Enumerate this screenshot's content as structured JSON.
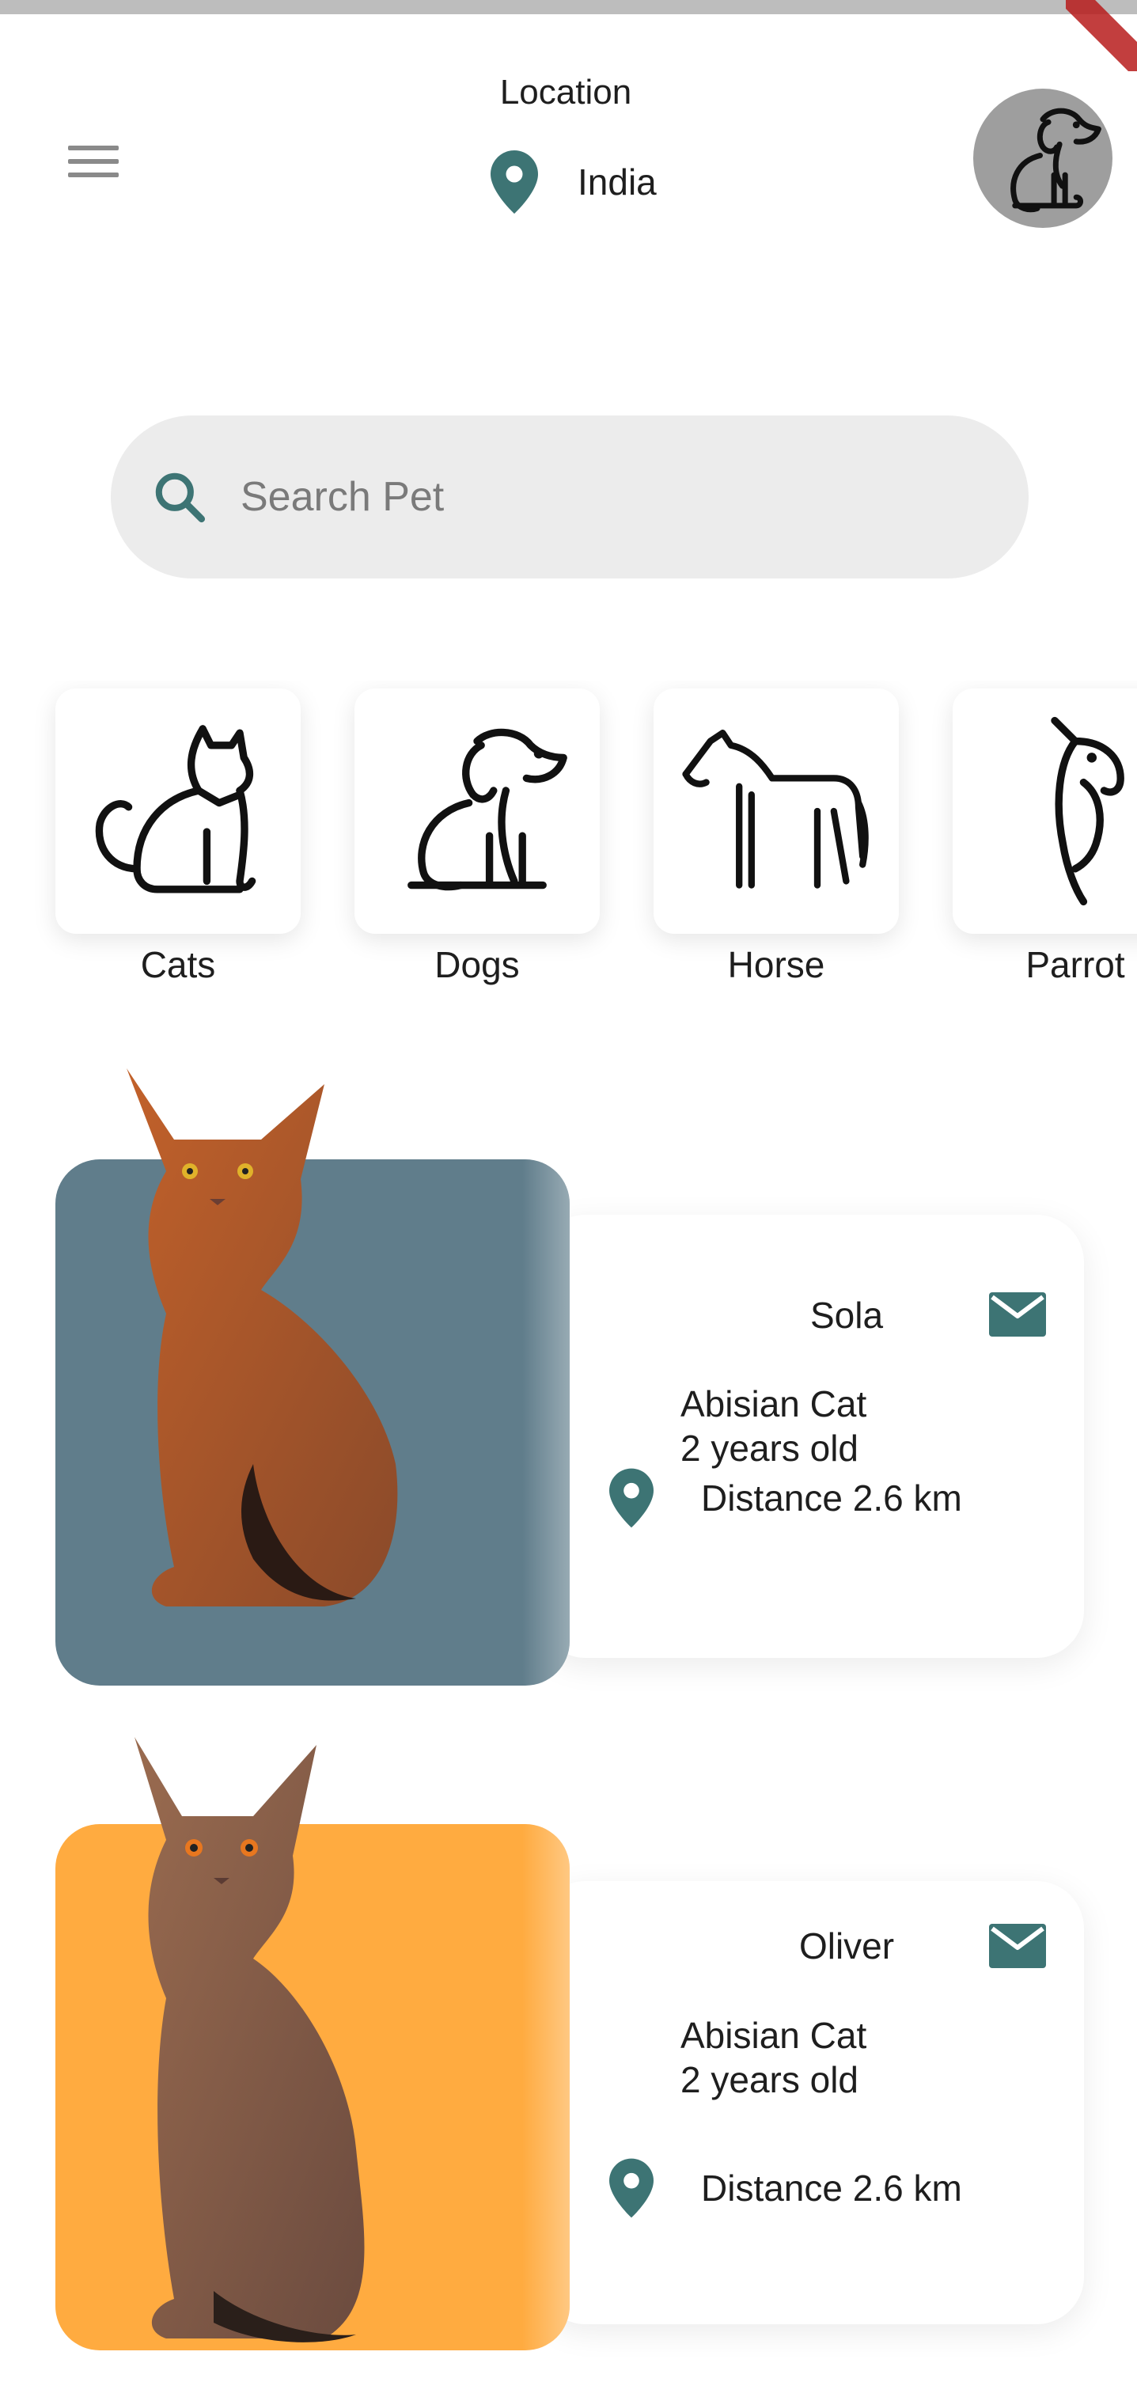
{
  "header": {
    "location_label": "Location",
    "location_value": "India",
    "menu_icon": "menu-icon",
    "location_icon": "map-pin-icon",
    "avatar_icon": "dog-avatar-icon"
  },
  "search": {
    "placeholder": "Search Pet",
    "icon": "search-icon"
  },
  "categories": [
    {
      "label": "Cats",
      "icon": "cat-outline-icon"
    },
    {
      "label": "Dogs",
      "icon": "dog-outline-icon"
    },
    {
      "label": "Horse",
      "icon": "horse-outline-icon"
    },
    {
      "label": "Parrot",
      "icon": "parrot-outline-icon"
    }
  ],
  "pets": [
    {
      "name": "Sola",
      "breed": "Abisian Cat",
      "age": "2 years old",
      "distance": "Distance 2.6 km",
      "card_color": "#607d8b"
    },
    {
      "name": "Oliver",
      "breed": "Abisian Cat",
      "age": "2 years old",
      "distance": "Distance 2.6 km",
      "card_color": "#ffab40"
    }
  ],
  "colors": {
    "accent": "#3d7474",
    "search_bg": "#ececec",
    "avatar_bg": "#9e9e9e"
  }
}
